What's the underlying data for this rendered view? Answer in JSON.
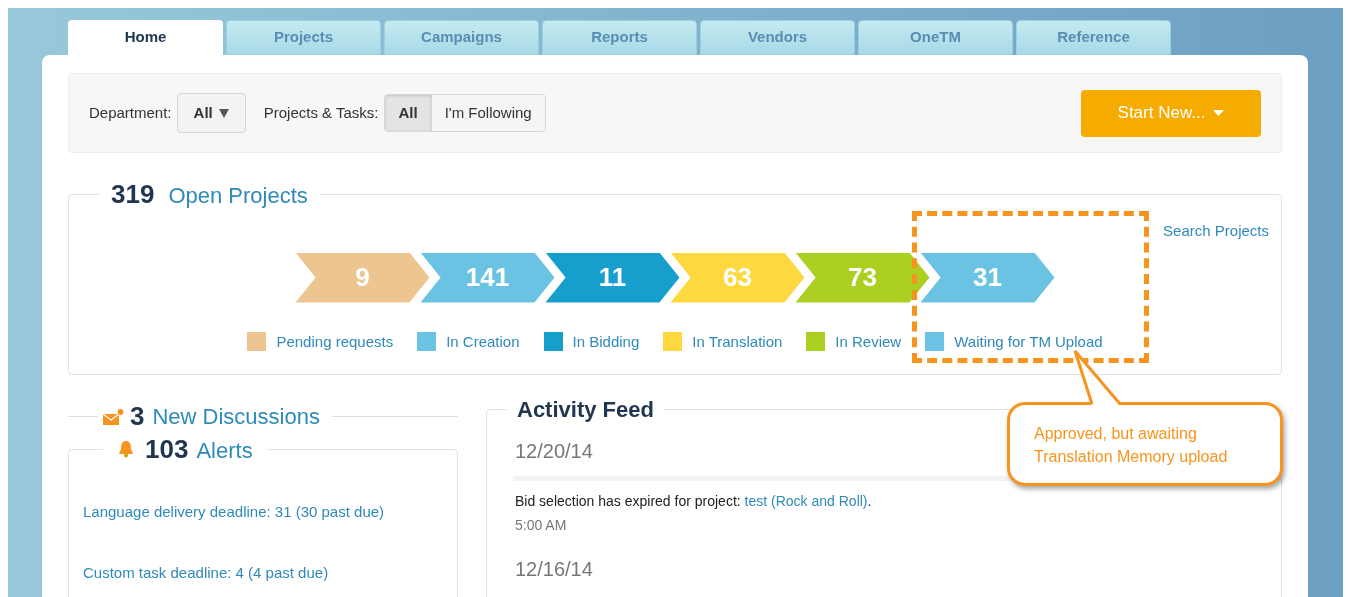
{
  "tabs": [
    {
      "label": "Home",
      "selected": true
    },
    {
      "label": "Projects",
      "selected": false
    },
    {
      "label": "Campaigns",
      "selected": false
    },
    {
      "label": "Reports",
      "selected": false
    },
    {
      "label": "Vendors",
      "selected": false
    },
    {
      "label": "OneTM",
      "selected": false
    },
    {
      "label": "Reference",
      "selected": false
    }
  ],
  "toolbar": {
    "department_label": "Department:",
    "department_value": "All",
    "filter_label": "Projects & Tasks:",
    "filters": [
      {
        "label": "All",
        "selected": true
      },
      {
        "label": "I'm Following",
        "selected": false
      }
    ],
    "start_button": "Start New..."
  },
  "open_projects": {
    "count": "319",
    "label": "Open Projects",
    "search_link": "Search Projects",
    "stages": [
      {
        "value": "9",
        "label": "Pending requests",
        "color": "#ecc590"
      },
      {
        "value": "141",
        "label": "In Creation",
        "color": "#6ac3e3"
      },
      {
        "value": "11",
        "label": "In Bidding",
        "color": "#169fcc"
      },
      {
        "value": "63",
        "label": "In Translation",
        "color": "#fdd93f"
      },
      {
        "value": "73",
        "label": "In Review",
        "color": "#abd022"
      },
      {
        "value": "31",
        "label": "Waiting for TM Upload",
        "color": "#6ac3e3"
      }
    ]
  },
  "annotation": {
    "text": "Approved, but awaiting Translation Memory upload"
  },
  "discussions": {
    "count": "3",
    "label": "New Discussions"
  },
  "alerts": {
    "count": "103",
    "label": "Alerts",
    "items": [
      "Language delivery deadline: 31 (30 past due)",
      "Custom task deadline: 4 (4 past due)"
    ]
  },
  "activity_feed": {
    "title": "Activity Feed",
    "days": [
      {
        "date": "12/20/14",
        "entries": [
          {
            "text": "Bid selection has expired for project: ",
            "link": "test (Rock and Roll)",
            "suffix": ".",
            "time": "5:00 AM"
          }
        ]
      },
      {
        "date": "12/16/14"
      }
    ]
  }
}
